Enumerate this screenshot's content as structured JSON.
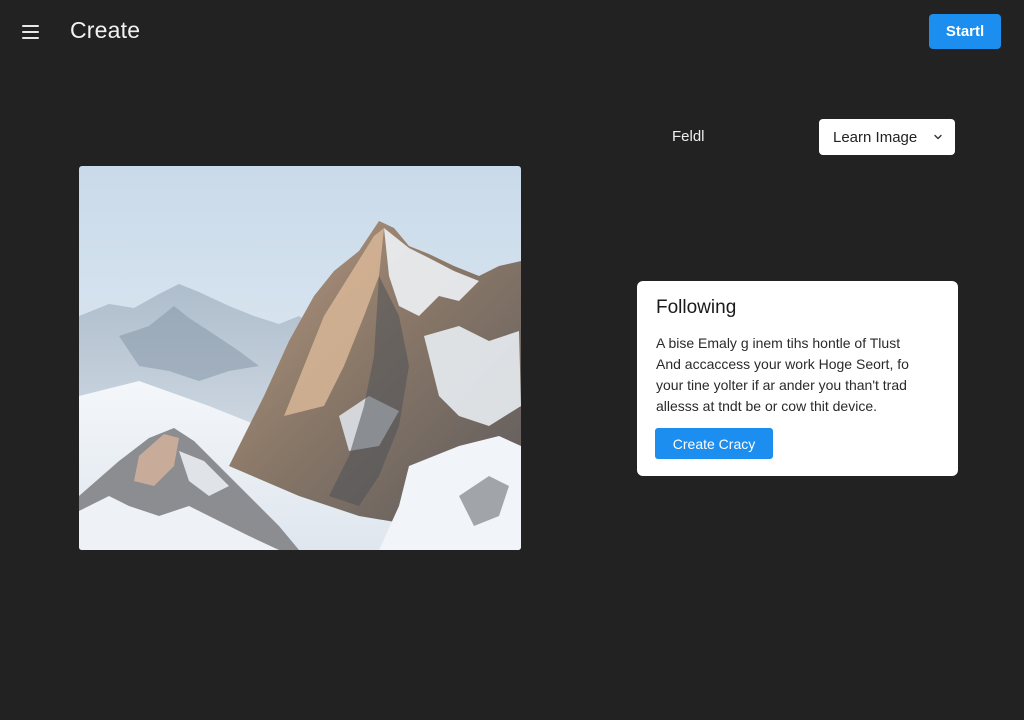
{
  "header": {
    "menu_icon": "hamburger-menu-icon",
    "title": "Create",
    "start_label": "Startl"
  },
  "options": {
    "field_label": "Feldl",
    "select_value": "Learn Image",
    "select_icon": "chevron-down-icon"
  },
  "card": {
    "title": "Following",
    "lines": [
      "A bise Emaly g inem tihs hontle of Tlust",
      "And accaccess your work Hoge Seort, fo",
      "your tine yolter if ar ander you than't trad",
      "allesss at tndt be or cow thit device."
    ],
    "button_label": "Create Cracy"
  },
  "colors": {
    "background": "#222222",
    "accent": "#1b8ef0",
    "card": "#ffffff"
  }
}
